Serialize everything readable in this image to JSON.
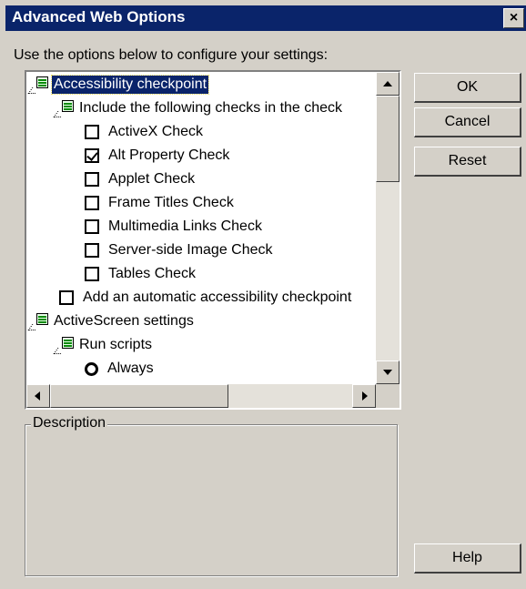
{
  "window": {
    "title": "Advanced Web Options",
    "close_glyph": "×"
  },
  "intro_text": "Use the options below to configure your settings:",
  "tree": {
    "items": [
      {
        "type": "node",
        "label": "Accessibility checkpoint",
        "selected": true
      },
      {
        "type": "node",
        "label": "Include the following checks in the check"
      },
      {
        "type": "checkbox",
        "label": "ActiveX Check",
        "checked": false
      },
      {
        "type": "checkbox",
        "label": "Alt Property Check",
        "checked": true
      },
      {
        "type": "checkbox",
        "label": "Applet Check",
        "checked": false
      },
      {
        "type": "checkbox",
        "label": "Frame Titles Check",
        "checked": false
      },
      {
        "type": "checkbox",
        "label": "Multimedia Links Check",
        "checked": false
      },
      {
        "type": "checkbox",
        "label": "Server-side Image Check",
        "checked": false
      },
      {
        "type": "checkbox",
        "label": "Tables Check",
        "checked": false
      },
      {
        "type": "checkbox",
        "label": "Add an automatic accessibility checkpoint",
        "checked": false
      },
      {
        "type": "node",
        "label": "ActiveScreen settings"
      },
      {
        "type": "node",
        "label": "Run scripts"
      },
      {
        "type": "radio",
        "label": "Always",
        "selected": true
      }
    ]
  },
  "buttons": {
    "ok": "OK",
    "cancel": "Cancel",
    "reset": "Reset",
    "help": "Help"
  },
  "description": {
    "legend": "Description",
    "text": ""
  }
}
